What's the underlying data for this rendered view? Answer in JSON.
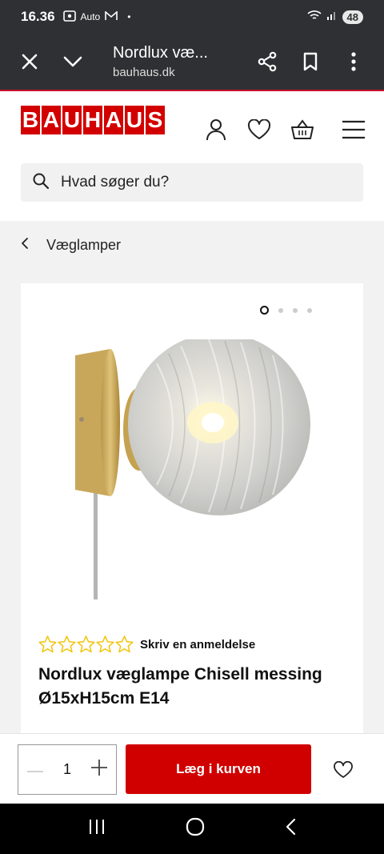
{
  "status_bar": {
    "time": "16.36",
    "left_icons": [
      "screen-record-icon",
      "auto-label",
      "gmail-icon",
      "dot-icon"
    ],
    "auto_label": "Auto",
    "battery": "48"
  },
  "browser": {
    "page_title": "Nordlux væ...",
    "url": "bauhaus.dk",
    "icons": [
      "close-icon",
      "chevron-down-icon",
      "share-icon",
      "bookmark-icon",
      "more-icon"
    ]
  },
  "header": {
    "logo_letters": [
      "B",
      "A",
      "U",
      "H",
      "A",
      "U",
      "S"
    ],
    "search_placeholder": "Hvad søger du?",
    "icons": [
      "user-icon",
      "heart-icon",
      "basket-icon",
      "menu-icon"
    ]
  },
  "breadcrumb": {
    "label": "Væglamper"
  },
  "product": {
    "image_count": 4,
    "active_image": 1,
    "rating_stars": 5,
    "rating_value": 0,
    "review_link": "Skriv en anmeldelse",
    "title": "Nordlux væglampe Chisell messing Ø15xH15cm E14"
  },
  "purchase": {
    "quantity": "1",
    "add_to_cart": "Læg i kurven"
  },
  "colors": {
    "brand_red": "#d30000",
    "star_yellow": "#f2c200",
    "dark_bar": "#2f3033"
  }
}
